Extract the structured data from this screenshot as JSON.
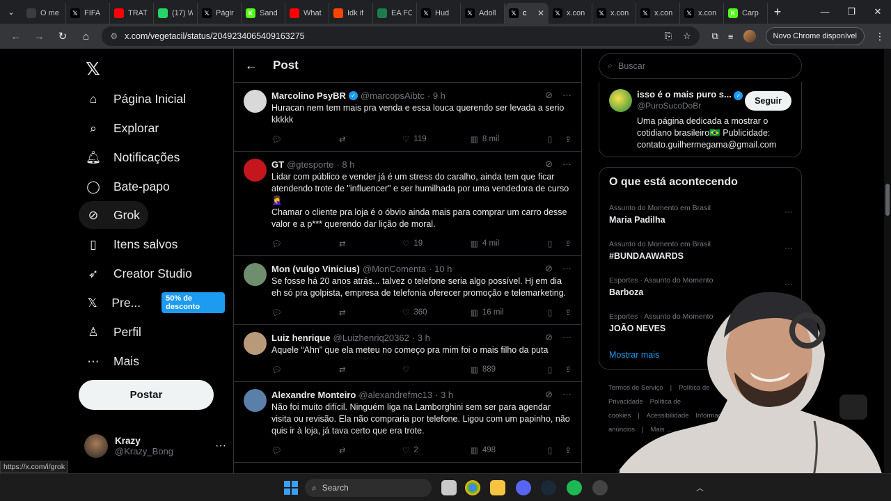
{
  "browser": {
    "tabs": [
      {
        "title": "O me",
        "fav": "yt-icon",
        "color": "#3c3c3c"
      },
      {
        "title": "FIFA",
        "fav": "x-logo-icon",
        "color": "#000000"
      },
      {
        "title": "TRAT",
        "fav": "youtube-icon",
        "color": "#ff0000"
      },
      {
        "title": "(17) W",
        "fav": "whatsapp-icon",
        "color": "#25d366"
      },
      {
        "title": "Págir",
        "fav": "x-logo-icon",
        "color": "#000000"
      },
      {
        "title": "Sand",
        "fav": "k-icon",
        "color": "#53fc18"
      },
      {
        "title": "What",
        "fav": "youtube-icon",
        "color": "#ff0000"
      },
      {
        "title": "Idk if",
        "fav": "reddit-icon",
        "color": "#ff4500"
      },
      {
        "title": "EA FC",
        "fav": "fut-icon",
        "color": "#1e7b4e"
      },
      {
        "title": "Hud",
        "fav": "x-logo-icon",
        "color": "#000000"
      },
      {
        "title": "Adoll",
        "fav": "x-logo-icon",
        "color": "#000000"
      },
      {
        "title": "c",
        "fav": "x-logo-icon",
        "color": "#000000",
        "active": true
      },
      {
        "title": "x.con",
        "fav": "x-logo-icon",
        "color": "#000000"
      },
      {
        "title": "x.con",
        "fav": "x-logo-icon",
        "color": "#000000"
      },
      {
        "title": "x.con",
        "fav": "x-logo-icon",
        "color": "#000000"
      },
      {
        "title": "x.con",
        "fav": "x-logo-icon",
        "color": "#000000"
      },
      {
        "title": "Carp",
        "fav": "k-icon",
        "color": "#53fc18"
      }
    ],
    "url": "x.com/vegetacil/status/2049234065409163275",
    "update_label": "Novo Chrome disponível",
    "status_url": "https://x.com/i/grok"
  },
  "left_nav": {
    "items": [
      {
        "label": "Página Inicial",
        "icon": "home-icon"
      },
      {
        "label": "Explorar",
        "icon": "search-icon"
      },
      {
        "label": "Notificações",
        "icon": "bell-icon"
      },
      {
        "label": "Bate-papo",
        "icon": "chat-icon"
      },
      {
        "label": "Grok",
        "icon": "grok-icon"
      },
      {
        "label": "Itens salvos",
        "icon": "bookmark-icon"
      },
      {
        "label": "Creator Studio",
        "icon": "rocket-icon"
      },
      {
        "label": "Pre...",
        "icon": "x-logo-icon"
      },
      {
        "label": "Perfil",
        "icon": "person-icon"
      },
      {
        "label": "Mais",
        "icon": "more-circle-icon"
      }
    ],
    "premium_badge": "50% de desconto",
    "post_label": "Postar",
    "account": {
      "name": "Krazy",
      "handle": "@Krazy_Bong"
    }
  },
  "center": {
    "header_title": "Post",
    "replies": [
      {
        "name": "Marcolino PsyBR",
        "verified": true,
        "handle": "@marcopsAibtc",
        "time": "· 9 h",
        "avatar_color": "#d9d9d9",
        "text": "Huracan nem tem mais pra venda e essa louca querendo ser levada a serio kkkkk",
        "replies": "",
        "reposts": "",
        "likes": "119",
        "views": "8 mil"
      },
      {
        "name": "GT",
        "verified": false,
        "handle": "@gtesporte",
        "time": "· 8 h",
        "avatar_color": "#c4161c",
        "text": "Lidar com público e vender já é um stress do caralho, ainda tem que ficar atendendo trote de \"influencer\" e ser humilhada por uma vendedora de curso 🤦‍♀️",
        "text2": "Chamar o cliente pra loja é o óbvio ainda mais para comprar um carro desse valor e a p*** querendo dar lição de moral.",
        "replies": "",
        "reposts": "",
        "likes": "19",
        "views": "4 mil"
      },
      {
        "name": "Mon (vulgo Vinicius)",
        "verified": false,
        "handle": "@MonComenta",
        "time": "· 10 h",
        "avatar_color": "#6f8e6e",
        "text": "Se fosse há 20 anos atrás... talvez o telefone seria algo possível. Hj em dia eh só pra golpista, empresa de telefonia oferecer promoção e telemarketing.",
        "replies": "",
        "reposts": "",
        "likes": "360",
        "views": "16 mil"
      },
      {
        "name": "Luiz henrique",
        "verified": false,
        "handle": "@Luizhenriq20362",
        "time": "· 3 h",
        "avatar_color": "#b89a7a",
        "text": "Aquele “Ahn” que ela meteu no começo pra mim foi o mais filho da puta",
        "replies": "",
        "reposts": "",
        "likes": "",
        "views": "889"
      },
      {
        "name": "Alexandre Monteiro",
        "verified": false,
        "handle": "@alexandrefmc13",
        "time": "· 3 h",
        "avatar_color": "#5a7fa8",
        "text": "Não foi muito difícil. Ninguém liga na Lamborghini sem ser para agendar visita ou revisão. Ela não compraria por telefone. Ligou com um papinho, não quis ir à loja, já tava certo que era trote.",
        "replies": "",
        "reposts": "",
        "likes": "2",
        "views": "498"
      }
    ]
  },
  "right": {
    "search_placeholder": "Buscar",
    "profile": {
      "name": "isso é o mais puro s...",
      "handle": "@PuroSucoDoBr",
      "follow_label": "Seguir",
      "bio": "Uma página dedicada a mostrar o cotidiano brasileiro🇧🇷 Publicidade: contato.guilhermegama@gmail.com"
    },
    "trends_title": "O que está acontecendo",
    "trends": [
      {
        "category": "Assunto do Momento em Brasil",
        "name": "Maria Padilha"
      },
      {
        "category": "Assunto do Momento em Brasil",
        "name": "#BUNDAAWARDS"
      },
      {
        "category": "Esportes · Assunto do Momento",
        "name": "Barboza"
      },
      {
        "category": "Esportes · Assunto do Momento",
        "name": "JOÃO NEVES"
      }
    ],
    "show_more": "Mostrar mais",
    "footer": [
      "Termos de Serviço",
      "|",
      "Política de Privacidade",
      "Política de cookies",
      "|",
      "Acessibilidade",
      "Informações de anúncios",
      "|",
      "Mais ..."
    ]
  },
  "taskbar": {
    "search_label": "Search"
  },
  "colors": {
    "accent": "#1d9bf0",
    "bg": "#000000",
    "border": "#2f3336",
    "muted": "#71767b"
  }
}
